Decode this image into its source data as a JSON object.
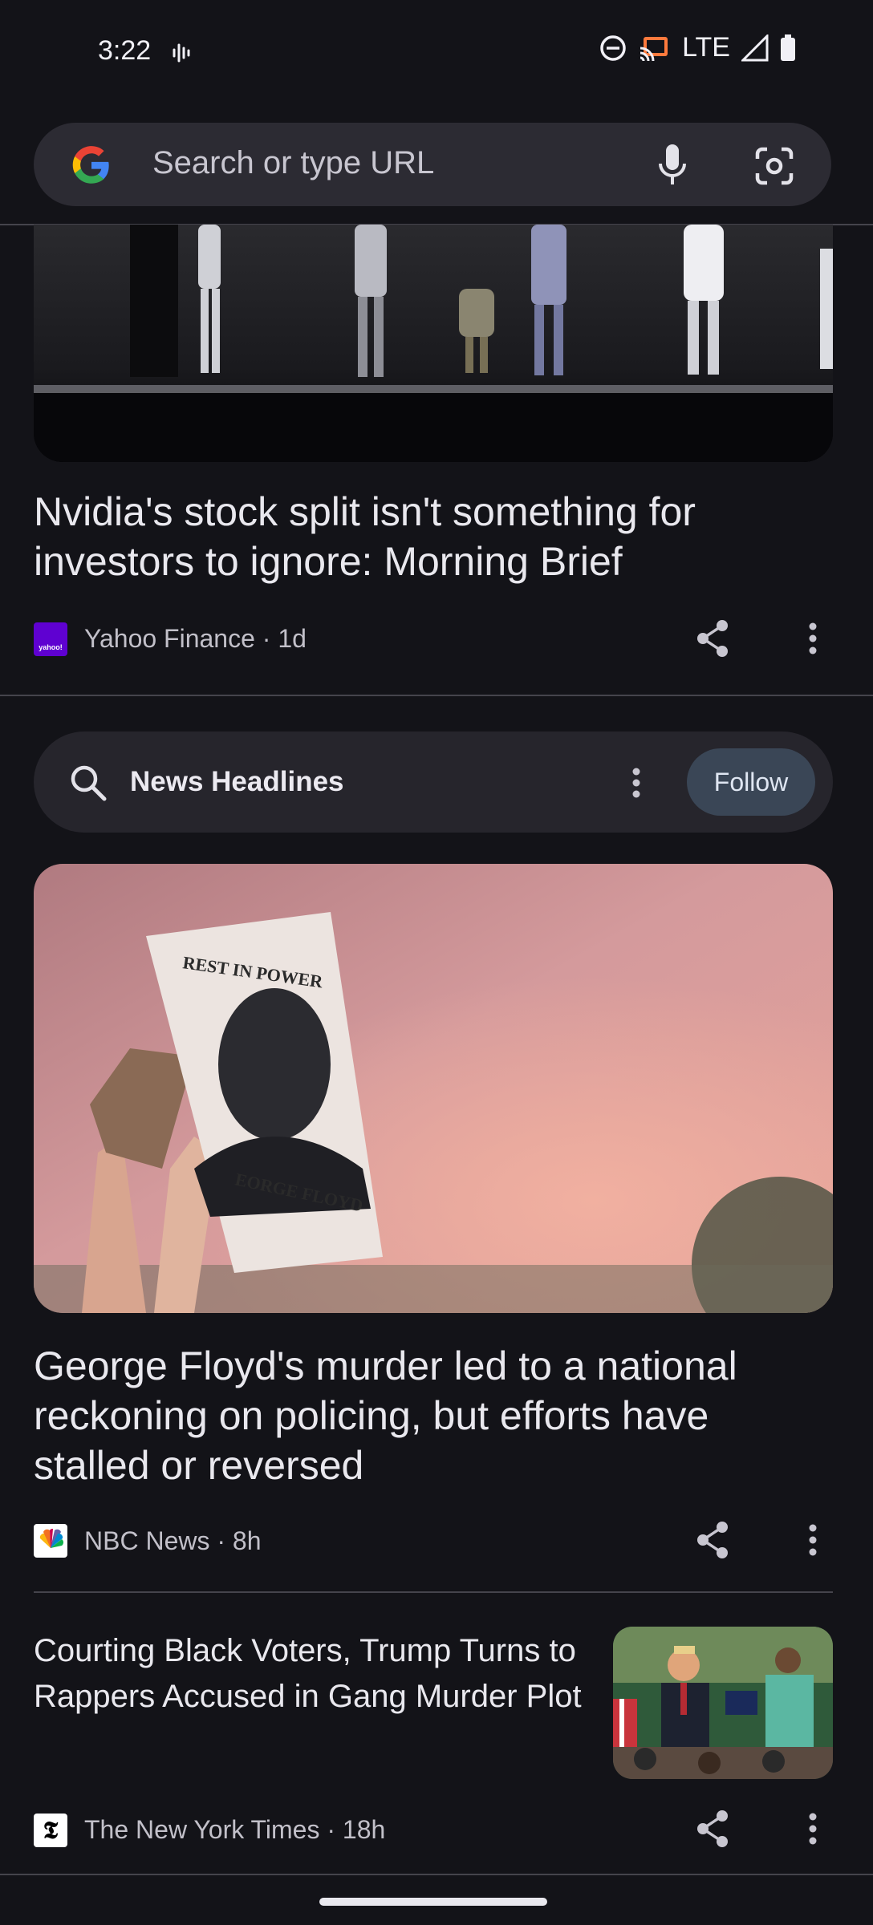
{
  "status_bar": {
    "time": "3:22",
    "network": "LTE",
    "icons": [
      "voicemail-wave-icon",
      "do-not-disturb-icon",
      "cast-icon",
      "signal-icon",
      "battery-icon"
    ]
  },
  "search": {
    "placeholder": "Search or type URL",
    "icons": [
      "google-g-icon",
      "microphone-icon",
      "google-lens-icon"
    ]
  },
  "feed": {
    "article1": {
      "title": "Nvidia's stock split isn't something for investors to ignore: Morning Brief",
      "source": "Yahoo Finance · 1d",
      "logo_text": "yahoo!"
    },
    "topic": {
      "title": "News Headlines",
      "follow_label": "Follow"
    },
    "article2": {
      "title": "George Floyd's murder led to a national reckoning on policing, but efforts have stalled or reversed",
      "source": "NBC News · 8h",
      "sign_top": "REST IN POWER",
      "sign_bottom": "EORGE FLOYD"
    },
    "article3": {
      "title": "Courting Black Voters, Trump Turns to Rappers Accused in Gang Murder Plot",
      "source": "The New York Times · 18h",
      "logo_text": "𝕿"
    }
  },
  "colors": {
    "background": "#131318",
    "search_bg": "#2c2b33",
    "follow_bg": "#3a4656"
  }
}
